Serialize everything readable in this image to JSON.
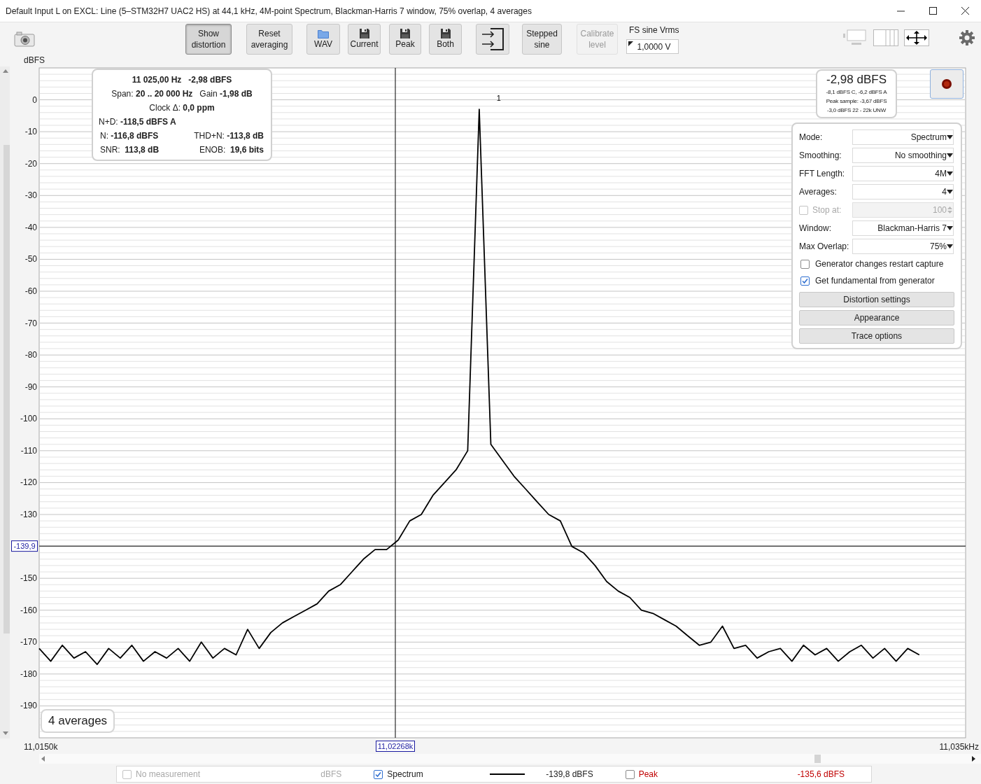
{
  "window": {
    "title": "Default Input L on EXCL: Line (5–STM32H7 UAC2 HS) at 44,1 kHz, 4M-point Spectrum, Blackman-Harris 7 window, 75% overlap, 4 averages"
  },
  "toolbar": {
    "buttons": [
      {
        "kind": "camera",
        "selected": false,
        "disabled": false
      },
      {
        "kind": "plain",
        "lines": [
          "Show",
          "distortion"
        ],
        "selected": true,
        "disabled": false
      },
      {
        "kind": "plain",
        "lines": [
          "Reset",
          "averaging"
        ],
        "selected": false,
        "disabled": false
      },
      {
        "kind": "folder",
        "lines": [
          "WAV"
        ],
        "selected": false,
        "disabled": false
      },
      {
        "kind": "disk",
        "lines": [
          "Current"
        ],
        "selected": false,
        "disabled": false
      },
      {
        "kind": "disk",
        "lines": [
          "Peak"
        ],
        "selected": false,
        "disabled": false
      },
      {
        "kind": "disk",
        "lines": [
          "Both"
        ],
        "selected": false,
        "disabled": false
      },
      {
        "kind": "export",
        "selected": false,
        "disabled": false
      },
      {
        "kind": "plain",
        "lines": [
          "Stepped",
          "sine"
        ],
        "selected": false,
        "disabled": false
      },
      {
        "kind": "plain",
        "lines": [
          "Calibrate",
          "level"
        ],
        "selected": false,
        "disabled": true
      }
    ],
    "fs_field": {
      "label": "FS sine Vrms",
      "value": "1,0000 V"
    }
  },
  "chart": {
    "chart_data": {
      "type": "line",
      "ylabel": "dBFS",
      "ylim": [
        -200,
        10
      ],
      "grid": true,
      "ref_lines": [
        {
          "axis": "y",
          "value": -139.9,
          "label": "-139,9"
        }
      ],
      "yticks": [
        0,
        -10,
        -20,
        -30,
        -40,
        -50,
        -60,
        -70,
        -80,
        -90,
        -100,
        -110,
        -120,
        -130,
        -150,
        -160,
        -170,
        -180,
        -190
      ],
      "categories": [
        null,
        null,
        null,
        null,
        null,
        null,
        null,
        null,
        null,
        null,
        null,
        null,
        null,
        null,
        null,
        null,
        null,
        null,
        null,
        null,
        null,
        null,
        null,
        null,
        null,
        null,
        null,
        null,
        null,
        null,
        null,
        null,
        null,
        null,
        null,
        null,
        null,
        null,
        null,
        null,
        null,
        null,
        null,
        null,
        null,
        null,
        null,
        null,
        null,
        null,
        null,
        null,
        null,
        null,
        null,
        null,
        null,
        null,
        null,
        null,
        null,
        null,
        null,
        null,
        null,
        null,
        null,
        null,
        null,
        null,
        null,
        null,
        null,
        null,
        null,
        null,
        null
      ],
      "series": [
        {
          "name": "Spectrum",
          "color": "#000000",
          "values": [
            -172,
            -176,
            -171,
            -175,
            -173,
            -177,
            -172,
            -175,
            -171,
            -176,
            -173,
            -175,
            -172,
            -176,
            -170,
            -175,
            -172,
            -174,
            -166,
            -172,
            -167,
            -164,
            -162,
            -160,
            -158,
            -154,
            -152,
            -148,
            -144,
            -141,
            -141,
            -138,
            -132,
            -130,
            -124,
            -120,
            -116,
            -110,
            -3,
            -108,
            -113,
            -118,
            -122,
            -126,
            -130,
            -132,
            -140,
            -142,
            -146,
            -151,
            -154,
            -156,
            -160,
            -161,
            -163,
            -165,
            -168,
            -171,
            -170,
            -165,
            -172,
            -171,
            -175,
            -173,
            -172,
            -176,
            -171,
            -174,
            -172,
            -176,
            -173,
            -171,
            -175,
            -172,
            -176,
            -172,
            -174
          ]
        }
      ],
      "annotations": [
        "1"
      ]
    },
    "x_axis_labels": [
      "11,0150k",
      "11,035kHz"
    ],
    "cursor": {
      "x_label": "11,02268k"
    }
  },
  "info": {
    "rows": [
      {
        "kind": "heading",
        "texts": [
          "11 025,00 Hz",
          "-2,98 dBFS"
        ]
      },
      {
        "kind": "center",
        "texts": [
          "Span: **20 .. 20 000 Hz**",
          "Gain **-1,98 dB**"
        ]
      },
      {
        "kind": "center",
        "texts": [
          "Clock Δ: **0,0 ppm**"
        ]
      },
      {
        "kind": "left",
        "texts": [
          "N+D: **-118,5 dBFS A**"
        ]
      },
      {
        "kind": "split",
        "texts": [
          "N: **-116,8 dBFS**",
          "THD+N: **-113,8 dB**"
        ]
      },
      {
        "kind": "split",
        "texts": [
          "SNR:  **113,8 dB**",
          "ENOB:  **19,6 bits**"
        ]
      }
    ]
  },
  "level": {
    "reading": "-2,98 dBFS",
    "lines": [
      "-8,1 dBFS C, -6,2 dBFS A",
      "Peak sample: -3,67 dBFS",
      "-3,0 dBFS 22 - 22k UNW"
    ]
  },
  "settings": {
    "rows": [
      {
        "kind": "select",
        "label": "Mode:",
        "value": "Spectrum"
      },
      {
        "kind": "select",
        "label": "Smoothing:",
        "value": "No smoothing"
      },
      {
        "kind": "select",
        "label": "FFT Length:",
        "value": "4M"
      },
      {
        "kind": "select",
        "label": "Averages:",
        "value": "4"
      },
      {
        "kind": "spin",
        "label": "Stop at:",
        "value": "100",
        "checked": false,
        "disabled": true
      },
      {
        "kind": "select",
        "label": "Window:",
        "value": "Blackman-Harris 7"
      },
      {
        "kind": "select",
        "label": "Max Overlap:",
        "value": "75%"
      },
      {
        "kind": "checkbox",
        "label": "Generator changes restart capture",
        "checked": false,
        "disabled": false
      },
      {
        "kind": "checkbox",
        "label": "Get fundamental from generator",
        "checked": true,
        "disabled": false
      },
      {
        "kind": "button",
        "label": "Distortion settings"
      },
      {
        "kind": "button",
        "label": "Appearance"
      },
      {
        "kind": "button",
        "label": "Trace options"
      }
    ]
  },
  "averages_badge": "4 averages",
  "legend": {
    "items": [
      {
        "kind": "plain",
        "label": "No measurement",
        "value": "dBFS",
        "checked": false,
        "disabled": true
      },
      {
        "kind": "trace",
        "value": "-139,8 dBFS",
        "checked": true,
        "disabled": false,
        "color": "#000000"
      },
      {
        "kind": "plain",
        "label": "Peak",
        "value": "-135,6 dBFS",
        "checked": false,
        "disabled": false,
        "color": "#c00000"
      }
    ]
  }
}
